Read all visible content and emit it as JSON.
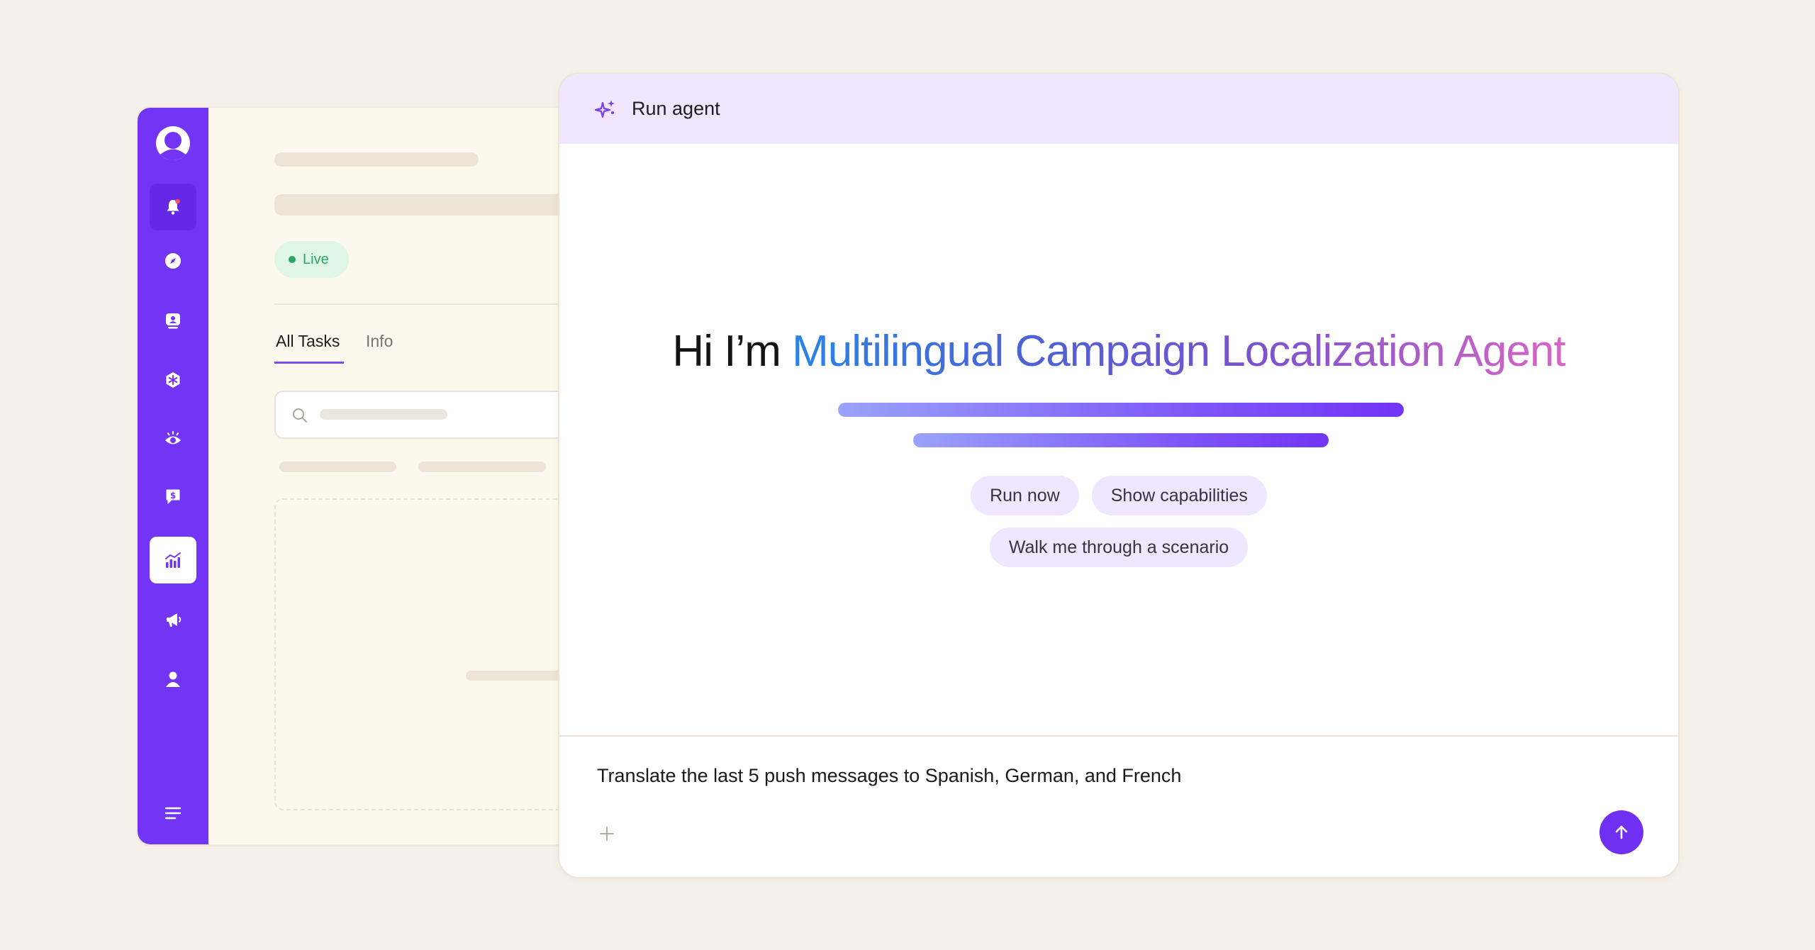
{
  "background_app": {
    "status_badge": "Live",
    "tabs": [
      {
        "label": "All Tasks",
        "active": true
      },
      {
        "label": "Info",
        "active": false
      }
    ],
    "sidebar": {
      "items": [
        {
          "icon": "bell-icon",
          "state": "highlight"
        },
        {
          "icon": "compass-icon",
          "state": "normal"
        },
        {
          "icon": "user-card-icon",
          "state": "normal"
        },
        {
          "icon": "snowflake-icon",
          "state": "normal"
        },
        {
          "icon": "eye-icon",
          "state": "normal"
        },
        {
          "icon": "dollar-message-icon",
          "state": "normal"
        },
        {
          "icon": "chart-icon",
          "state": "active"
        },
        {
          "icon": "megaphone-icon",
          "state": "normal"
        },
        {
          "icon": "person-icon",
          "state": "normal"
        }
      ],
      "menu_icon": "menu-icon"
    }
  },
  "agent": {
    "header_title": "Run agent",
    "greeting_lead": "Hi I’m",
    "agent_name": "Multilingual Campaign Localization Agent",
    "chips_row1": [
      "Run now",
      "Show capabilities"
    ],
    "chips_row2": [
      "Walk me through a scenario"
    ],
    "composer_text": "Translate the last 5 push messages to Spanish, German, and French"
  },
  "colors": {
    "page_bg": "#f5f0ea",
    "sidebar": "#7235f5",
    "header_bg": "#f0e6ff",
    "accent": "#7030f2",
    "live_green": "#28a862"
  }
}
